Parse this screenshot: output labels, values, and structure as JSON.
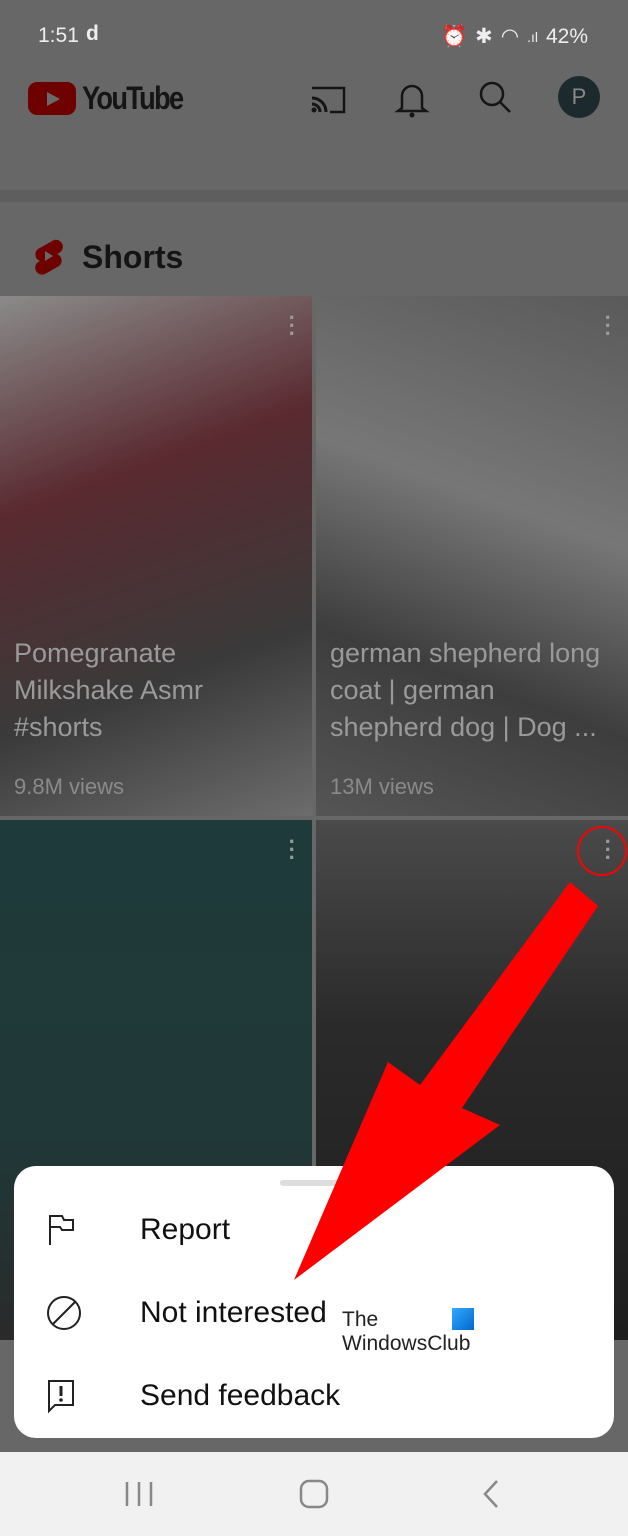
{
  "status_bar": {
    "time": "1:51",
    "carrier_icon": "d",
    "battery": "42%"
  },
  "header": {
    "logo_text": "YouTube",
    "avatar_letter": "P"
  },
  "shorts": {
    "title": "Shorts",
    "items": [
      {
        "caption": "Pomegranate Milkshake Asmr #shorts",
        "views": "9.8M views"
      },
      {
        "caption": "german shepherd long coat | german shepherd dog | Dog ...",
        "views": "13M views"
      },
      {
        "caption": "",
        "views": ""
      },
      {
        "caption": "",
        "views": ""
      }
    ]
  },
  "menu": {
    "items": [
      {
        "label": "Report",
        "icon": "flag-icon"
      },
      {
        "label": "Not interested",
        "icon": "block-icon"
      },
      {
        "label": "Send feedback",
        "icon": "feedback-icon"
      }
    ]
  },
  "watermark": {
    "line1": "The",
    "line2": "WindowsClub"
  },
  "colors": {
    "annotation": "#ff0000",
    "accent": "#cc0000"
  }
}
